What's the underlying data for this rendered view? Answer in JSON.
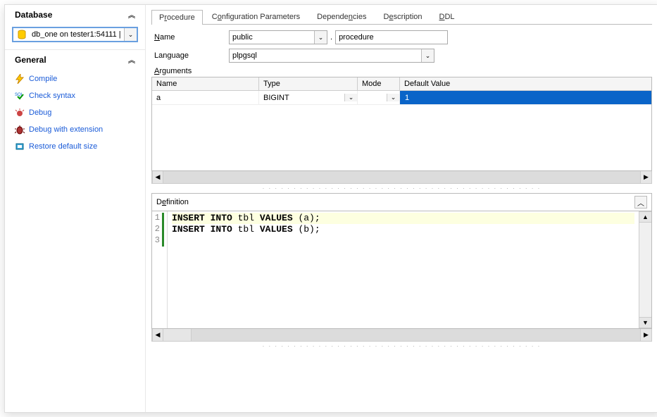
{
  "sidebar": {
    "database_header": "Database",
    "general_header": "General",
    "db_combo": "db_one on tester1:54111 |",
    "items": [
      {
        "label": "Compile"
      },
      {
        "label": "Check syntax"
      },
      {
        "label": "Debug"
      },
      {
        "label": "Debug with extension"
      },
      {
        "label": "Restore default size"
      }
    ]
  },
  "tabs": [
    "Procedure",
    "Configuration Parameters",
    "Dependencies",
    "Description",
    "DDL"
  ],
  "form": {
    "name_label": "Name",
    "name_schema": "public",
    "name_value": "procedure",
    "language_label": "Language",
    "language_value": "plpgsql",
    "arguments_label": "Arguments"
  },
  "args_grid": {
    "headers": {
      "name": "Name",
      "type": "Type",
      "mode": "Mode",
      "default": "Default Value"
    },
    "rows": [
      {
        "name": "a",
        "type": "BIGINT",
        "mode": "",
        "default": "1"
      }
    ]
  },
  "definition": {
    "header": "Definition",
    "lines": [
      {
        "n": "1",
        "text": "INSERT INTO tbl VALUES (a);"
      },
      {
        "n": "2",
        "text": "INSERT INTO tbl VALUES (b);"
      },
      {
        "n": "3",
        "text": ""
      }
    ]
  }
}
